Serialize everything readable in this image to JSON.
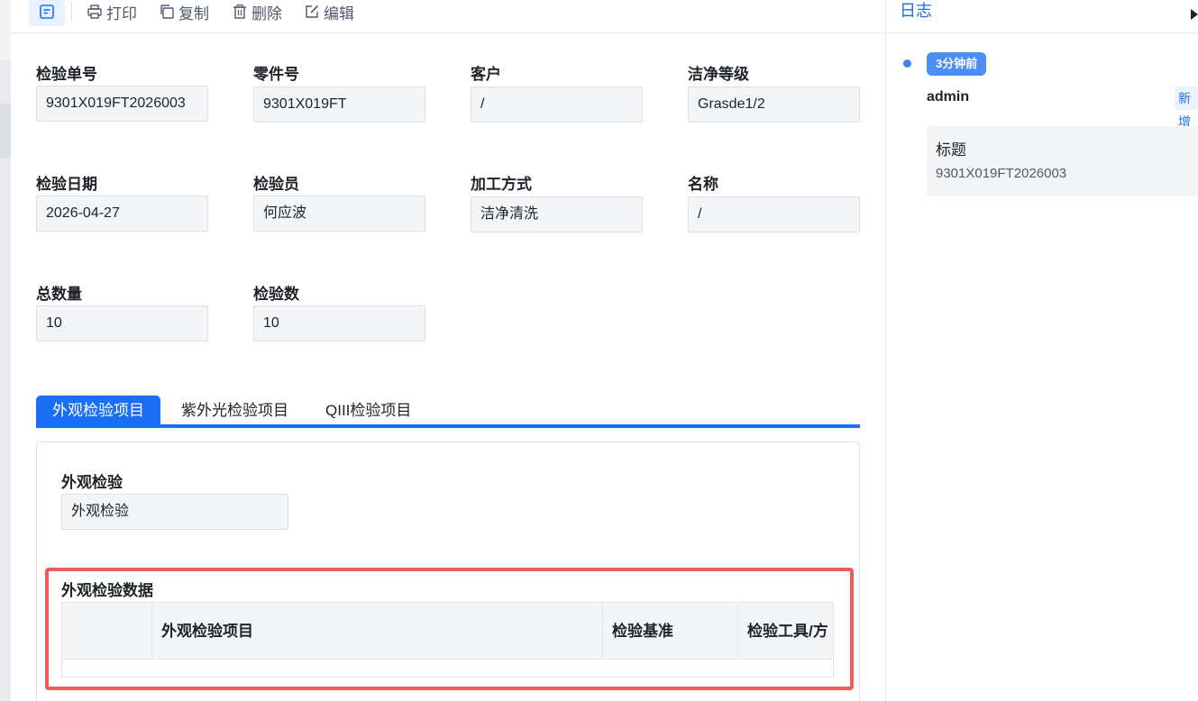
{
  "toolbar": {
    "print": "打印",
    "copy": "复制",
    "delete": "删除",
    "edit": "编辑"
  },
  "fields": [
    {
      "label": "检验单号",
      "value": "9301X019FT2026003"
    },
    {
      "label": "零件号",
      "value": "9301X019FT"
    },
    {
      "label": "客户",
      "value": "/"
    },
    {
      "label": "洁净等级",
      "value": "Grasde1/2"
    },
    {
      "label": "检验日期",
      "value": "2026-04-27"
    },
    {
      "label": "检验员",
      "value": "何应波"
    },
    {
      "label": "加工方式",
      "value": "洁净清洗"
    },
    {
      "label": "名称",
      "value": "/"
    },
    {
      "label": "总数量",
      "value": "10"
    },
    {
      "label": "检验数",
      "value": "10"
    }
  ],
  "tabs": [
    {
      "label": "外观检验项目",
      "active": true
    },
    {
      "label": "紫外光检验项目",
      "active": false
    },
    {
      "label": "QIII检验项目",
      "active": false
    }
  ],
  "panel": {
    "field_label": "外观检验",
    "field_value": "外观检验",
    "section_title": "外观检验数据",
    "columns": [
      "",
      "外观检验项目",
      "检验基准",
      "检验工具/方"
    ]
  },
  "side": {
    "title": "日志",
    "time": "3分钟前",
    "user": "admin",
    "action": "新增",
    "card_key": "标题",
    "card_value": "9301X019FT2026003"
  },
  "colors": {
    "accent": "#1a6ef5",
    "highlight": "#f05a5a"
  }
}
